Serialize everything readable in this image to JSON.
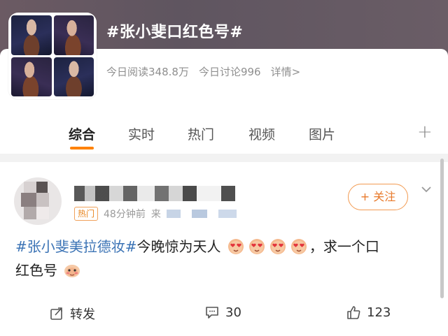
{
  "topic": {
    "title": "#张小斐口红色号#",
    "reads": "今日阅读348.8万",
    "discussions": "今日讨论996",
    "details_link": "详情>"
  },
  "tabs": [
    {
      "label": "综合",
      "active": true
    },
    {
      "label": "实时",
      "active": false
    },
    {
      "label": "热门",
      "active": false
    },
    {
      "label": "视频",
      "active": false
    },
    {
      "label": "图片",
      "active": false
    }
  ],
  "tabs_add_icon": "plus-icon",
  "post": {
    "badge": "热门",
    "time": "48分钟前",
    "source_prefix": "来",
    "follow_label": "+ 关注",
    "hashtag": "#张小斐美拉德妆#",
    "text_after_hashtag": "今晚惊为天人",
    "text_after_emojis": "，求一个口",
    "text_line2": "红色号",
    "emoji_count": 4,
    "actions": {
      "repost": "转发",
      "comments": "30",
      "likes": "123"
    }
  },
  "colors": {
    "accent_orange": "#ff8200",
    "hashtag_blue": "#3b73b5",
    "follow_border": "#f29b52"
  }
}
